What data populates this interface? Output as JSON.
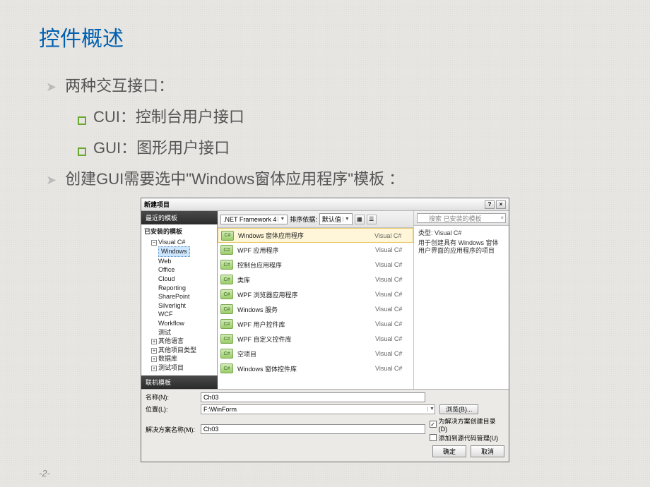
{
  "slide": {
    "title": "控件概述",
    "bullet1": "两种交互接口：",
    "sub1": "CUI：控制台用户接口",
    "sub2": "GUI：图形用户接口",
    "bullet2": "创建GUI需要选中\"Windows窗体应用程序\"模板 ：",
    "page_num": "-2-"
  },
  "dialog": {
    "title": "新建项目",
    "help_label": "?",
    "close_label": "×",
    "left": {
      "header": "最近的模板",
      "section": "已安装的模板",
      "footer": "联机模板",
      "root": "Visual C#",
      "items": [
        "Windows",
        "Web",
        "Office",
        "Cloud",
        "Reporting",
        "SharePoint",
        "Silverlight",
        "WCF",
        "Workflow",
        "测试"
      ],
      "siblings": [
        "其他语言",
        "其他项目类型",
        "数据库",
        "测试项目"
      ]
    },
    "toolbar": {
      "framework": ".NET Framework 4",
      "sort_label": "排序依据:",
      "sort_value": "默认值"
    },
    "templates": [
      {
        "name": "Windows 窗体应用程序",
        "lang": "Visual C#",
        "selected": true
      },
      {
        "name": "WPF 应用程序",
        "lang": "Visual C#"
      },
      {
        "name": "控制台应用程序",
        "lang": "Visual C#"
      },
      {
        "name": "类库",
        "lang": "Visual C#"
      },
      {
        "name": "WPF 浏览器应用程序",
        "lang": "Visual C#"
      },
      {
        "name": "Windows 服务",
        "lang": "Visual C#"
      },
      {
        "name": "WPF 用户控件库",
        "lang": "Visual C#"
      },
      {
        "name": "WPF 自定义控件库",
        "lang": "Visual C#"
      },
      {
        "name": "空项目",
        "lang": "Visual C#"
      },
      {
        "name": "Windows 窗体控件库",
        "lang": "Visual C#"
      }
    ],
    "search": {
      "placeholder": "搜索 已安装的模板"
    },
    "desc": {
      "type": "类型: Visual C#",
      "text": "用于创建具有 Windows 窗体用户界面的应用程序的项目"
    },
    "fields": {
      "name_label": "名称(N):",
      "name_value": "Ch03",
      "loc_label": "位置(L):",
      "loc_value": "F:\\WinForm",
      "browse": "浏览(B)...",
      "sol_label": "解决方案名称(M):",
      "sol_value": "Ch03",
      "chk1": "为解决方案创建目录(D)",
      "chk2": "添加到源代码管理(U)"
    },
    "ok": "确定",
    "cancel": "取消"
  }
}
